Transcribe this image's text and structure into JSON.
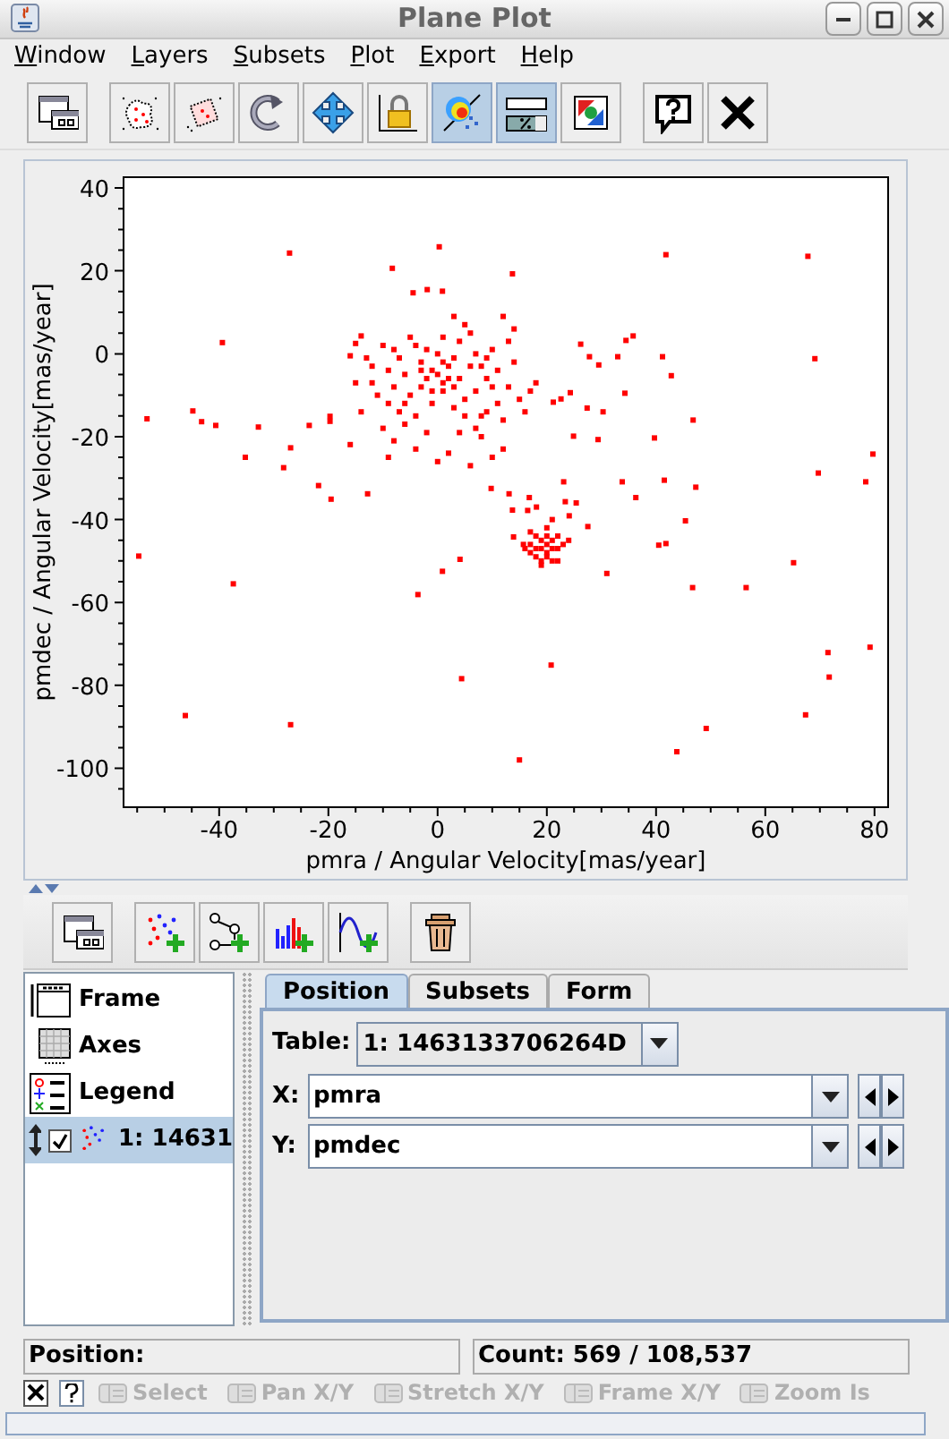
{
  "window": {
    "title": "Plane Plot"
  },
  "menu": [
    "Window",
    "Layers",
    "Subsets",
    "Plot",
    "Export",
    "Help"
  ],
  "toolbar": [
    {
      "kind": "windows",
      "selected": false
    },
    {
      "kind": "separator"
    },
    {
      "kind": "blob",
      "selected": false
    },
    {
      "kind": "region",
      "selected": false
    },
    {
      "kind": "replot",
      "selected": false
    },
    {
      "kind": "navigate",
      "selected": false
    },
    {
      "kind": "lock",
      "selected": false
    },
    {
      "kind": "density",
      "selected": true
    },
    {
      "kind": "percent",
      "selected": true
    },
    {
      "kind": "export",
      "selected": false
    },
    {
      "kind": "separator"
    },
    {
      "kind": "help",
      "selected": false
    },
    {
      "kind": "close",
      "selected": false
    }
  ],
  "plot": {
    "chart_data": {
      "type": "scatter",
      "xlabel": "pmra / Angular Velocity[mas/year]",
      "ylabel": "pmdec / Angular Velocity[mas/year]",
      "xlim": [
        -57.5,
        82.5
      ],
      "ylim": [
        -109.4,
        42.6
      ],
      "xticks": [
        -40,
        -20,
        0,
        20,
        40,
        60,
        80
      ],
      "yticks": [
        40,
        20,
        0,
        -20,
        -40,
        -60,
        -80,
        -100
      ],
      "x": [
        -27.1,
        0.3,
        -8.3,
        13.7,
        -4.5,
        -1.9,
        0.9,
        41.8,
        67.8,
        -39.4,
        -53.2,
        -44.8,
        -43.2,
        -40.6,
        -32.8,
        -35.2,
        -26.9,
        -28.2,
        -23.5,
        -19.7,
        -19.7,
        -16,
        -21.8,
        -19.5,
        -12.8,
        -54.7,
        -37.4,
        -3.6,
        0.9,
        4.1,
        -46.2,
        -26.9,
        4.4,
        20.8,
        15,
        43.8,
        49.2,
        67.4,
        71.5,
        71.7,
        79.2,
        31,
        46.7,
        56.5,
        65.2,
        45.4,
        40.5,
        41.8,
        47.3,
        41.5,
        33.8,
        36.3,
        39.7,
        46.8,
        69.7,
        78.4,
        79.7,
        69.1,
        41.2,
        42.8,
        35.8,
        34.5,
        26.2,
        27.8,
        29.5,
        33,
        34.3,
        30.3,
        29.4,
        24.9,
        27.4,
        24.3,
        21.2,
        22.6,
        27.5,
        25.4,
        23.1,
        23.4,
        24.1,
        21,
        18.1,
        16.8,
        16.5,
        13.7,
        13.1,
        9.8,
        13.9,
        15.7,
        -16,
        -15,
        -14,
        -13,
        -12,
        -10,
        -9,
        -8,
        -7,
        -6,
        -5,
        -4,
        -3,
        -2,
        -1,
        0,
        1,
        2,
        3,
        4,
        5,
        6,
        7,
        8,
        9,
        10,
        11,
        12,
        13,
        14,
        -11,
        -9,
        -7,
        -5,
        -3,
        -1,
        1,
        3,
        5,
        7,
        9,
        11,
        13,
        15,
        17,
        -14,
        -10,
        -8,
        -6,
        -4,
        -2,
        0,
        2,
        4,
        6,
        8,
        10,
        12,
        -2,
        0,
        1,
        2,
        -1,
        3,
        -3,
        4,
        6,
        -6,
        8,
        -12,
        10,
        14,
        -8,
        5,
        3,
        -4,
        7,
        9,
        -15,
        1,
        -9,
        12,
        16,
        18,
        17,
        18,
        19,
        20,
        21,
        22,
        17,
        18,
        19,
        20,
        21,
        22,
        23,
        18,
        19,
        20,
        21,
        16,
        24,
        20,
        19,
        22,
        17,
        20
      ],
      "series": [
        {
          "color": "#ff0000",
          "values": [
            24.3,
            25.8,
            20.6,
            19.3,
            14.7,
            15.5,
            15.1,
            23.9,
            23.5,
            2.7,
            -15.7,
            -13.8,
            -16.4,
            -17.3,
            -17.7,
            -25,
            -22.7,
            -27.5,
            -17.3,
            -15.1,
            -16.3,
            -21.9,
            -31.8,
            -35.1,
            -33.8,
            -48.8,
            -55.5,
            -58.1,
            -52.5,
            -49.6,
            -87.3,
            -89.5,
            -78.4,
            -75.1,
            -98,
            -96,
            -90.4,
            -87.1,
            -72.1,
            -78,
            -70.8,
            -53,
            -56.4,
            -56.4,
            -50.4,
            -40.3,
            -46.2,
            -45.8,
            -32.2,
            -30.5,
            -30.9,
            -34.7,
            -20.3,
            -16,
            -28.8,
            -30.9,
            -24.2,
            -1.2,
            -0.7,
            -5.3,
            4.3,
            3.2,
            2.3,
            -0.7,
            -2.7,
            -0.7,
            -9.5,
            -14,
            -20.7,
            -19.9,
            -13.1,
            -9.4,
            -11.7,
            -10.9,
            -41.7,
            -36,
            -30.9,
            -35.7,
            -39.1,
            -40,
            -37,
            -34.7,
            -37.8,
            -37.7,
            -33.8,
            -32.5,
            -44.2,
            -46,
            -0.5,
            2.5,
            4.3,
            -1,
            -3,
            2,
            -4,
            -8,
            -1,
            -5,
            4,
            2,
            -2,
            1,
            -4,
            0,
            -2,
            -6,
            -1,
            3,
            7,
            5,
            0,
            -3,
            -6,
            1,
            -4,
            9,
            3,
            -2,
            -10,
            -12,
            -14,
            -10,
            -8,
            -12,
            -9,
            -13,
            -11,
            -9,
            -14,
            -12,
            -8,
            -11,
            -9,
            -14,
            -18,
            -21,
            -17,
            -23,
            -19,
            -26,
            -24,
            -19,
            -27,
            -20,
            -25,
            -23,
            -6,
            -5,
            -7,
            -3,
            -9,
            -8,
            -4,
            -6,
            -3,
            -12,
            -15,
            -7,
            -8,
            6,
            1,
            -15,
            9,
            -15,
            -18,
            -1,
            -7,
            4,
            -25,
            -16,
            -14,
            -7,
            -43,
            -44,
            -45,
            -44,
            -45,
            -44,
            -46,
            -47,
            -47,
            -46,
            -47,
            -47,
            -46,
            -49,
            -50,
            -48,
            -50,
            -47,
            -45,
            -42,
            -51,
            -50,
            -48,
            -49
          ]
        }
      ]
    }
  },
  "layer_toolbar": [
    {
      "kind": "windows"
    },
    {
      "kind": "separator"
    },
    {
      "kind": "scatter"
    },
    {
      "kind": "link"
    },
    {
      "kind": "histogram"
    },
    {
      "kind": "function"
    },
    {
      "kind": "separator"
    },
    {
      "kind": "delete"
    }
  ],
  "layers": [
    {
      "kind": "frame",
      "label": "Frame",
      "selected": false
    },
    {
      "kind": "axes",
      "label": "Axes",
      "selected": false
    },
    {
      "kind": "legend",
      "label": "Legend",
      "selected": false
    },
    {
      "kind": "layer",
      "label": "1: 14631",
      "selected": true,
      "checked": true
    }
  ],
  "tabs": [
    {
      "label": "Position",
      "selected": true
    },
    {
      "label": "Subsets",
      "selected": false
    },
    {
      "label": "Form",
      "selected": false
    }
  ],
  "table": {
    "label": "Table:",
    "value": "1: 1463133706264D"
  },
  "coords": [
    {
      "label": "X:",
      "value": "pmra"
    },
    {
      "label": "Y:",
      "value": "pmdec"
    }
  ],
  "status": {
    "position": "Position:",
    "count": "Count: 569 / 108,537"
  },
  "modes": [
    {
      "label": "Select",
      "disabled": true
    },
    {
      "label": "Pan X/Y",
      "disabled": true
    },
    {
      "label": "Stretch X/Y",
      "disabled": true
    },
    {
      "label": "Frame X/Y",
      "disabled": true
    },
    {
      "label": "Zoom Is",
      "disabled": true
    }
  ],
  "progress": {
    "level": 0
  }
}
